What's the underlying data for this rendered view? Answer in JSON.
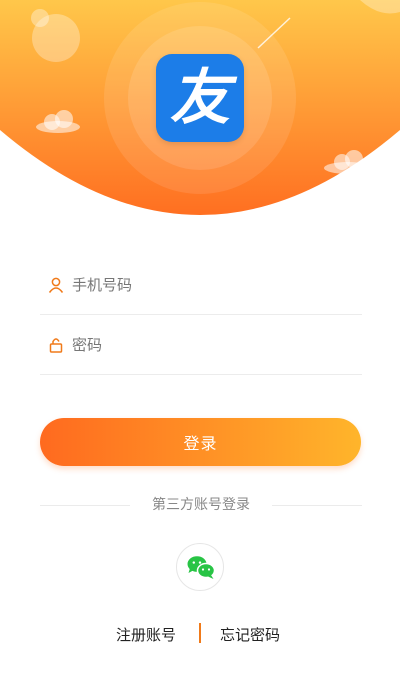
{
  "app": {
    "logo_char": "友"
  },
  "login_form": {
    "phone_placeholder": "手机号码",
    "password_placeholder": "密码",
    "login_label": "登录"
  },
  "third_party": {
    "label": "第三方账号登录"
  },
  "links": {
    "register": "注册账号",
    "forgot_password": "忘记密码"
  },
  "icons": {
    "phone_field": "user-icon",
    "password_field": "lock-icon",
    "third_party": "wechat-icon"
  },
  "colors": {
    "header_gradient": [
      "#ffc74a",
      "#ff6f21"
    ],
    "logo_background": "#1c7de8",
    "button_gradient": [
      "#ff6a1f",
      "#ffb52b"
    ],
    "icon_accent": "#f07a1a",
    "wechat_green": "#28c445"
  }
}
